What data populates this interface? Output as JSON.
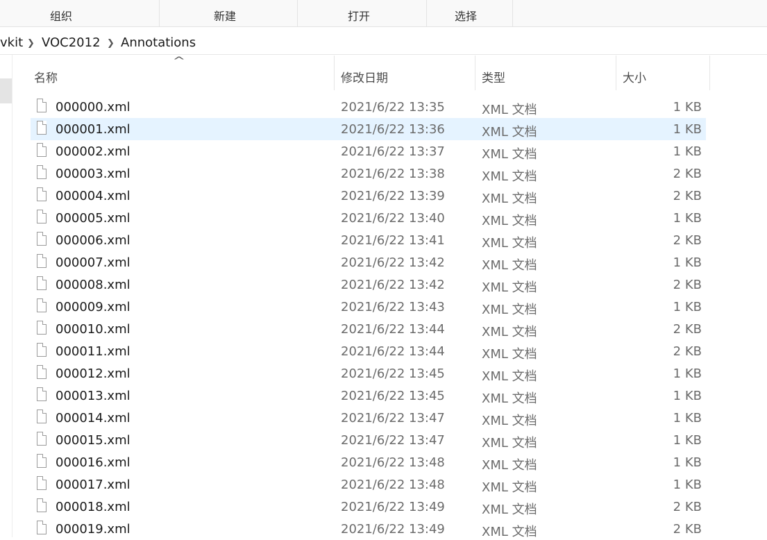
{
  "ribbon": {
    "groups": [
      {
        "label": "组织"
      },
      {
        "label": "新建"
      },
      {
        "label": "打开"
      },
      {
        "label": "选择"
      }
    ]
  },
  "address": {
    "crumbs": [
      "vkit",
      "VOC2012",
      "Annotations"
    ]
  },
  "columns": {
    "name": "名称",
    "modified": "修改日期",
    "type": "类型",
    "size": "大小",
    "sort_indicator": "^"
  },
  "icons": {
    "file": "file-icon",
    "chevron": "chevron-right-icon",
    "sort": "sort-ascending-icon"
  },
  "selected_index": 1,
  "files": [
    {
      "name": "000000.xml",
      "modified": "2021/6/22 13:35",
      "type": "XML 文档",
      "size": "1 KB"
    },
    {
      "name": "000001.xml",
      "modified": "2021/6/22 13:36",
      "type": "XML 文档",
      "size": "1 KB"
    },
    {
      "name": "000002.xml",
      "modified": "2021/6/22 13:37",
      "type": "XML 文档",
      "size": "1 KB"
    },
    {
      "name": "000003.xml",
      "modified": "2021/6/22 13:38",
      "type": "XML 文档",
      "size": "2 KB"
    },
    {
      "name": "000004.xml",
      "modified": "2021/6/22 13:39",
      "type": "XML 文档",
      "size": "2 KB"
    },
    {
      "name": "000005.xml",
      "modified": "2021/6/22 13:40",
      "type": "XML 文档",
      "size": "1 KB"
    },
    {
      "name": "000006.xml",
      "modified": "2021/6/22 13:41",
      "type": "XML 文档",
      "size": "2 KB"
    },
    {
      "name": "000007.xml",
      "modified": "2021/6/22 13:42",
      "type": "XML 文档",
      "size": "1 KB"
    },
    {
      "name": "000008.xml",
      "modified": "2021/6/22 13:42",
      "type": "XML 文档",
      "size": "2 KB"
    },
    {
      "name": "000009.xml",
      "modified": "2021/6/22 13:43",
      "type": "XML 文档",
      "size": "1 KB"
    },
    {
      "name": "000010.xml",
      "modified": "2021/6/22 13:44",
      "type": "XML 文档",
      "size": "2 KB"
    },
    {
      "name": "000011.xml",
      "modified": "2021/6/22 13:44",
      "type": "XML 文档",
      "size": "2 KB"
    },
    {
      "name": "000012.xml",
      "modified": "2021/6/22 13:45",
      "type": "XML 文档",
      "size": "1 KB"
    },
    {
      "name": "000013.xml",
      "modified": "2021/6/22 13:45",
      "type": "XML 文档",
      "size": "1 KB"
    },
    {
      "name": "000014.xml",
      "modified": "2021/6/22 13:47",
      "type": "XML 文档",
      "size": "1 KB"
    },
    {
      "name": "000015.xml",
      "modified": "2021/6/22 13:47",
      "type": "XML 文档",
      "size": "1 KB"
    },
    {
      "name": "000016.xml",
      "modified": "2021/6/22 13:48",
      "type": "XML 文档",
      "size": "1 KB"
    },
    {
      "name": "000017.xml",
      "modified": "2021/6/22 13:48",
      "type": "XML 文档",
      "size": "1 KB"
    },
    {
      "name": "000018.xml",
      "modified": "2021/6/22 13:49",
      "type": "XML 文档",
      "size": "2 KB"
    },
    {
      "name": "000019.xml",
      "modified": "2021/6/22 13:49",
      "type": "XML 文档",
      "size": "2 KB"
    }
  ]
}
